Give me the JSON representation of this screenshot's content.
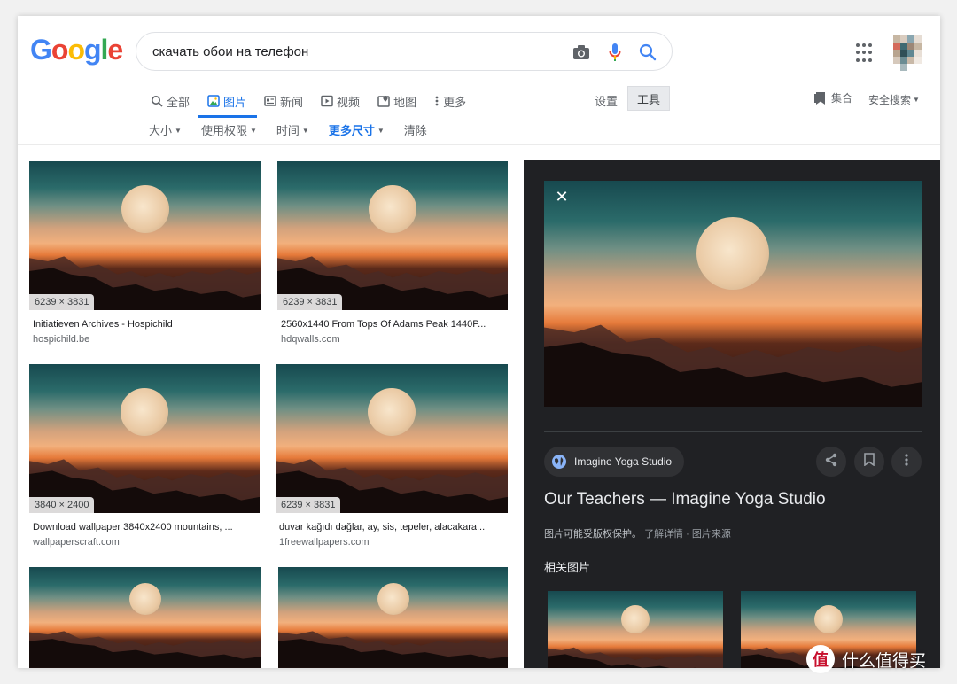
{
  "header": {
    "logo_letters": [
      {
        "ch": "G",
        "color": "#4285f4"
      },
      {
        "ch": "o",
        "color": "#ea4335"
      },
      {
        "ch": "o",
        "color": "#fbbc05"
      },
      {
        "ch": "g",
        "color": "#4285f4"
      },
      {
        "ch": "l",
        "color": "#34a853"
      },
      {
        "ch": "e",
        "color": "#ea4335"
      }
    ],
    "search_query": "скачать обои на телефон"
  },
  "nav": {
    "all": "全部",
    "images": "图片",
    "news": "新闻",
    "videos": "视频",
    "maps": "地图",
    "more": "更多",
    "settings": "设置",
    "tools": "工具",
    "collections": "集合",
    "safe_search": "安全搜索"
  },
  "filters": {
    "size": "大小",
    "usage_rights": "使用权限",
    "time": "时间",
    "more_sizes": "更多尺寸",
    "clear": "清除"
  },
  "results": [
    {
      "size": "6239 × 3831",
      "title": "Initiatieven Archives - Hospichild",
      "domain": "hospichild.be"
    },
    {
      "size": "6239 × 3831",
      "title": "2560x1440 From Tops Of Adams Peak 1440P...",
      "domain": "hdqwalls.com"
    },
    {
      "size": "3840 × 2400",
      "title": "Download wallpaper 3840x2400 mountains, ...",
      "domain": "wallpaperscraft.com"
    },
    {
      "size": "6239 × 3831",
      "title": "duvar kağıdı dağlar, ay, sis, tepeler, alacakara...",
      "domain": "1freewallpapers.com"
    }
  ],
  "panel": {
    "close": "✕",
    "source_name": "Imagine Yoga Studio",
    "title": "Our Teachers — Imagine Yoga Studio",
    "copyright_notice": "图片可能受版权保护。",
    "learn_more": "了解详情",
    "separator": "·",
    "image_source": "图片来源",
    "related_heading": "相关图片"
  },
  "watermark": {
    "icon_text": "值",
    "text": "什么值得买"
  },
  "colors": {
    "accent": "#1a73e8",
    "panel_bg": "#202124"
  }
}
